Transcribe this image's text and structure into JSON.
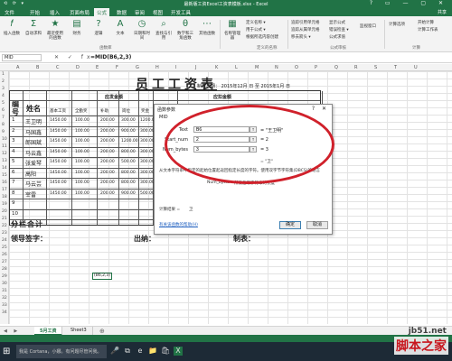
{
  "window": {
    "title": "最新版工资Excel工资表模板.xlsx - Excel",
    "qat": "⟲ ⟳ ▾",
    "controls": "? ▭ — ▢ ✕"
  },
  "ribbon": {
    "tabs": [
      "文件",
      "开始",
      "插入",
      "页面布局",
      "公式",
      "数据",
      "审阅",
      "视图",
      "开发工具"
    ],
    "active_tab": "公式",
    "share": "共享",
    "buttons": [
      {
        "label": "插入函数",
        "icon": "fx-icon"
      },
      {
        "label": "自动求和",
        "icon": "sum-icon"
      },
      {
        "label": "最近使用的函数",
        "icon": "star-icon"
      },
      {
        "label": "财务",
        "icon": "finance-icon"
      },
      {
        "label": "逻辑",
        "icon": "logic-icon"
      },
      {
        "label": "文本",
        "icon": "text-icon"
      },
      {
        "label": "日期和时间",
        "icon": "clock-icon"
      },
      {
        "label": "查找与引用",
        "icon": "lookup-icon"
      },
      {
        "label": "数学和三角函数",
        "icon": "math-icon"
      },
      {
        "label": "其他函数",
        "icon": "more-icon"
      },
      {
        "label": "名称管理器",
        "icon": "name-icon"
      }
    ],
    "small_items": [
      "定义名称 ▾",
      "用于公式 ▾",
      "根据所选内容创建",
      "追踪引用单元格",
      "追踪从属单元格",
      "移去箭头 ▾",
      "显示公式",
      "错误检查 ▾",
      "公式求值",
      "监视窗口",
      "计算选项",
      "开始计算",
      "计算工作表"
    ],
    "groups": [
      "函数库",
      "定义的名称",
      "公式审核",
      "计算"
    ]
  },
  "formula_bar": {
    "name_box": "MID",
    "icons": "✕ ✓ fx",
    "formula": "=MID(B6,2,3)"
  },
  "columns": [
    "A",
    "B",
    "C",
    "D",
    "E",
    "F",
    "G",
    "H",
    "I",
    "J",
    "K",
    "L",
    "M",
    "N",
    "O",
    "P",
    "Q",
    "R",
    "S",
    "T",
    "U"
  ],
  "rows": [
    "1",
    "2",
    "3",
    "4",
    "5",
    "6",
    "7",
    "8",
    "9",
    "10",
    "11",
    "12",
    "13",
    "14",
    "15",
    "16",
    "17",
    "18",
    "19",
    "20",
    "21",
    "22",
    "23",
    "24",
    "25",
    "26",
    "27",
    "28",
    "29",
    "30",
    "31",
    "32",
    "33",
    "34"
  ],
  "sheet": {
    "title": "员工工资表",
    "date_line": "制表日期： 2015年12月 日 至 2015年1月 日",
    "group_headers": [
      "应发金额",
      "应扣金额"
    ],
    "col_headers": [
      "编号",
      "姓名",
      "基本工资",
      "全勤奖",
      "补助",
      "岗位",
      "奖金"
    ],
    "employees": [
      {
        "no": "1",
        "name": "王卫明",
        "vals": [
          "1450.00",
          "100.00",
          "200.00",
          "300.00",
          "1200.00"
        ]
      },
      {
        "no": "2",
        "name": "马国鑫",
        "vals": [
          "1450.00",
          "100.00",
          "200.00",
          "900.00",
          "300.00"
        ]
      },
      {
        "no": "3",
        "name": "郎国斌",
        "vals": [
          "1450.00",
          "100.00",
          "200.00",
          "1200.00",
          "300.00"
        ]
      },
      {
        "no": "4",
        "name": "马云鑫",
        "vals": [
          "1450.00",
          "100.00",
          "200.00",
          "800.00",
          "300.00"
        ]
      },
      {
        "no": "5",
        "name": "张爱琴",
        "vals": [
          "1450.00",
          "100.00",
          "200.00",
          "500.00",
          "300.00"
        ]
      },
      {
        "no": "6",
        "name": "高阳",
        "vals": [
          "1450.00",
          "100.00",
          "200.00",
          "800.00",
          "300.00"
        ]
      },
      {
        "no": "7",
        "name": "马云芸",
        "vals": [
          "1450.00",
          "100.00",
          "200.00",
          "800.00",
          "300.00"
        ]
      },
      {
        "no": "8",
        "name": "宰雷",
        "vals": [
          "1450.00",
          "100.00",
          "200.00",
          "900.00",
          "500.00"
        ]
      },
      {
        "no": "9",
        "name": "",
        "vals": [
          "",
          "",
          "",
          "",
          ""
        ]
      },
      {
        "no": "10",
        "name": "",
        "vals": [
          "",
          "",
          "",
          "",
          ""
        ]
      },
      {
        "no": "11",
        "name": "",
        "vals": [
          "",
          "",
          "",
          "",
          ""
        ]
      }
    ],
    "total_label": "分栏合计",
    "signatures": [
      "领导签字：",
      "出纳：",
      "制表："
    ],
    "editing_cell": "(B6,2,3)"
  },
  "dialog": {
    "title": "函数参数",
    "controls": "? ✕",
    "function_name": "MID",
    "args": [
      {
        "label": "Text",
        "value": "B6",
        "result": "= \"王卫明\""
      },
      {
        "label": "Start_num",
        "value": "2",
        "result": "= 2"
      },
      {
        "label": "Num_bytes",
        "value": "3",
        "result": "= 3"
      }
    ],
    "pick_icon": "↑",
    "overall_result": "= \"卫\"",
    "description": "从文本字符串中指定的起始位置起返回指定长度的字符。使用双字节字符集(DBCS)的语言",
    "arg_help_label": "Num_bytes",
    "arg_help_text": "所要截取字符串的长度",
    "calc_result_label": "计算结果 =",
    "calc_result_value": "卫",
    "help_link": "有关该函数的帮助(H)",
    "ok": "确定",
    "cancel": "取消",
    "highlight_color": "#d0212b"
  },
  "sheet_tabs": {
    "nav": "◀ ▶",
    "tabs": [
      "5月工资",
      "Sheet3"
    ],
    "active": "5月工资",
    "add": "⊕"
  },
  "taskbar": {
    "start": "⊞",
    "search": "我是 Cortana，小娜。有问题尽管问我。",
    "icons": [
      "🎤",
      "⧉",
      "e",
      "📁",
      "🛍",
      "X"
    ]
  },
  "watermark": {
    "site": "jb51.net",
    "name": "脚本之家"
  },
  "colors": {
    "excel_green": "#217346",
    "taskbar": "#1d2a36",
    "watermark_red": "#c8161d"
  }
}
